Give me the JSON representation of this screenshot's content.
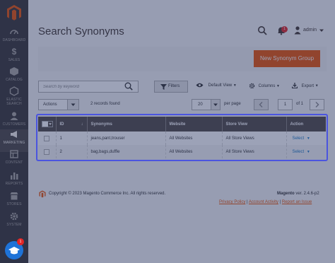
{
  "sidebar": {
    "items": [
      {
        "label": "DASHBOARD",
        "icon": "speedometer-icon"
      },
      {
        "label": "SALES",
        "icon": "dollar-icon"
      },
      {
        "label": "CATALOG",
        "icon": "box-icon"
      },
      {
        "label": "ELASTIC SEARCH",
        "icon": "hexagon-icon"
      },
      {
        "label": "CUSTOMERS",
        "icon": "user-icon"
      },
      {
        "label": "MARKETING",
        "icon": "megaphone-icon"
      },
      {
        "label": "CONTENT",
        "icon": "layout-icon"
      },
      {
        "label": "REPORTS",
        "icon": "bar-chart-icon"
      },
      {
        "label": "STORES",
        "icon": "store-icon"
      },
      {
        "label": "SYSTEM",
        "icon": "gear-icon"
      }
    ]
  },
  "header": {
    "title": "Search Synonyms",
    "notification_count": "1",
    "user": "admin"
  },
  "actions": {
    "primary_button": "New Synonym Group"
  },
  "toolbar": {
    "search_placeholder": "Search by keyword",
    "filters": "Filters",
    "view": "Default View",
    "columns": "Columns",
    "export": "Export",
    "mass_actions": "Actions",
    "records": "2 records found",
    "per_page_value": "20",
    "per_page_label": "per page",
    "page_value": "1",
    "of_pages": "of 1"
  },
  "grid": {
    "columns": [
      "ID",
      "Synonyms",
      "Website",
      "Store View",
      "Action"
    ],
    "rows": [
      {
        "id": "1",
        "synonyms": "jeans,pant,trouser",
        "website": "All Websites",
        "store_view": "All Store Views",
        "action": "Select"
      },
      {
        "id": "2",
        "synonyms": "bag,bags,duffle",
        "website": "All Websites",
        "store_view": "All Store Views",
        "action": "Select"
      }
    ]
  },
  "footer": {
    "copyright": "Copyright © 2023 Magento Commerce Inc. All rights reserved.",
    "brand": "Magento",
    "version": " ver. 2.4.6-p2",
    "privacy": "Privacy Policy",
    "sep1": " | ",
    "activity": "Account Activity",
    "sep2": " | ",
    "report": "Report an Issue"
  },
  "fab_badge": "1",
  "colors": {
    "accent": "#eb5202",
    "sidebar": "#373330",
    "grid_header": "#514943",
    "link": "#1979c3",
    "focus_ring": "#4b55df",
    "overlay": "#283462"
  }
}
